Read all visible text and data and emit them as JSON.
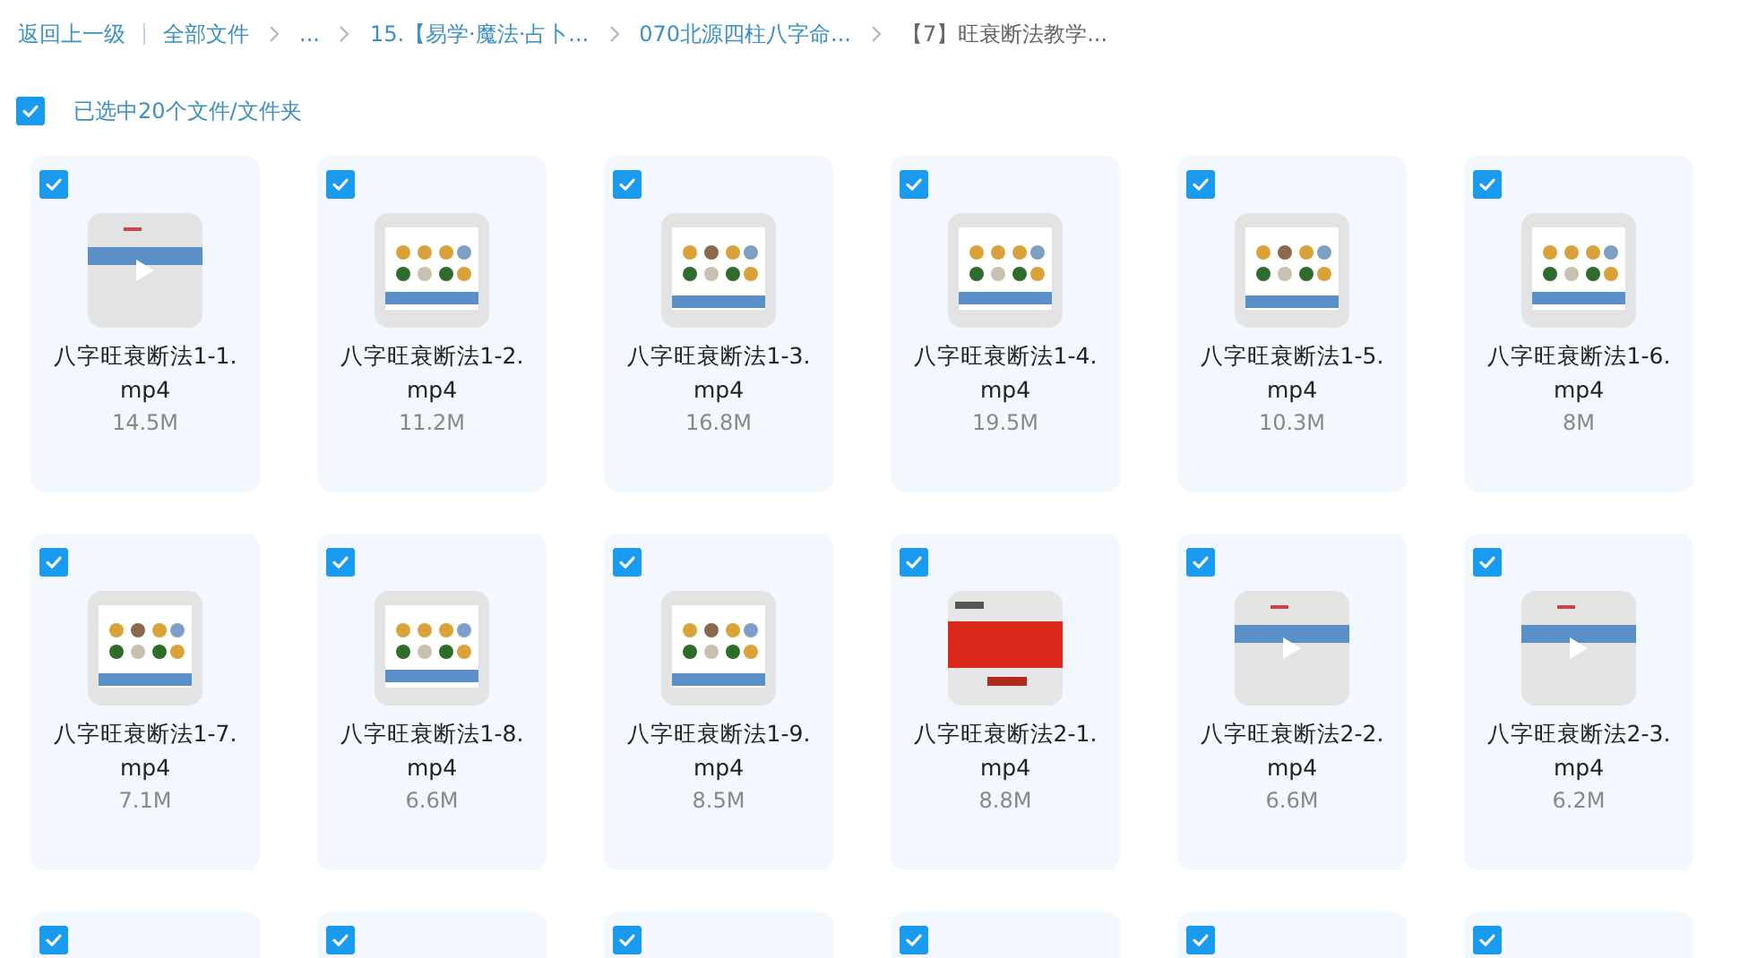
{
  "breadcrumb": {
    "back": "返回上一级",
    "items": [
      {
        "label": "全部文件",
        "current": false
      },
      {
        "label": "...",
        "current": false
      },
      {
        "label": "15.【易学·魔法·占卜...",
        "current": false
      },
      {
        "label": "070北源四柱八字命...",
        "current": false
      },
      {
        "label": "【7】旺衰断法教学...",
        "current": true
      }
    ]
  },
  "selection": {
    "checked": true,
    "label": "已选中20个文件/文件夹"
  },
  "files": [
    {
      "name": "八字旺衰断法1-1.mp4",
      "size": "14.5M",
      "checked": true
    },
    {
      "name": "八字旺衰断法1-2.mp4",
      "size": "11.2M",
      "checked": true
    },
    {
      "name": "八字旺衰断法1-3.mp4",
      "size": "16.8M",
      "checked": true
    },
    {
      "name": "八字旺衰断法1-4.mp4",
      "size": "19.5M",
      "checked": true
    },
    {
      "name": "八字旺衰断法1-5.mp4",
      "size": "10.3M",
      "checked": true
    },
    {
      "name": "八字旺衰断法1-6.mp4",
      "size": "8M",
      "checked": true
    },
    {
      "name": "八字旺衰断法1-7.mp4",
      "size": "7.1M",
      "checked": true
    },
    {
      "name": "八字旺衰断法1-8.mp4",
      "size": "6.6M",
      "checked": true
    },
    {
      "name": "八字旺衰断法1-9.mp4",
      "size": "8.5M",
      "checked": true
    },
    {
      "name": "八字旺衰断法2-1.mp4",
      "size": "8.8M",
      "checked": true
    },
    {
      "name": "八字旺衰断法2-2.mp4",
      "size": "6.6M",
      "checked": true
    },
    {
      "name": "八字旺衰断法2-3.mp4",
      "size": "6.2M",
      "checked": true
    },
    {
      "checked": true
    },
    {
      "checked": true
    },
    {
      "checked": true
    },
    {
      "checked": true
    },
    {
      "checked": true
    },
    {
      "checked": true
    }
  ]
}
